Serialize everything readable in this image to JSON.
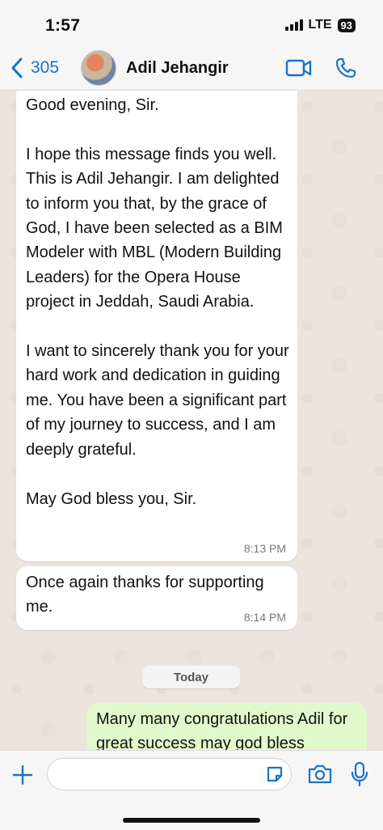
{
  "status_bar": {
    "time": "1:57",
    "network": "LTE",
    "battery": "93"
  },
  "header": {
    "back_count": "305",
    "contact_name": "Adil Jehangir",
    "accent_color": "#1a73c9"
  },
  "messages": [
    {
      "direction": "incoming",
      "text": "Good evening, Sir.\n\nI hope this message finds you well. This is Adil Jehangir. I am delighted to inform you that, by the grace of God, I have been selected as a BIM Modeler with MBL (Modern Building Leaders) for the Opera House project in Jeddah, Saudi Arabia.\n\nI want to sincerely thank you for your hard work and dedication in guiding me. You have been a significant part of my journey to success, and I am deeply grateful.\n\nMay God bless you, Sir.",
      "time": "8:13 PM"
    },
    {
      "direction": "incoming",
      "text": "Once again thanks for supporting me.",
      "time": "8:14 PM"
    },
    {
      "direction": "outgoing",
      "text": "Many many congratulations Adil for great success may god bless"
    }
  ],
  "date_separator": "Today",
  "input": {
    "placeholder": ""
  },
  "icons": {
    "back": "chevron-left-icon",
    "video": "video-camera-icon",
    "phone": "phone-icon",
    "attach": "plus-icon",
    "sticker": "sticker-icon",
    "camera": "camera-icon",
    "mic": "microphone-icon"
  }
}
